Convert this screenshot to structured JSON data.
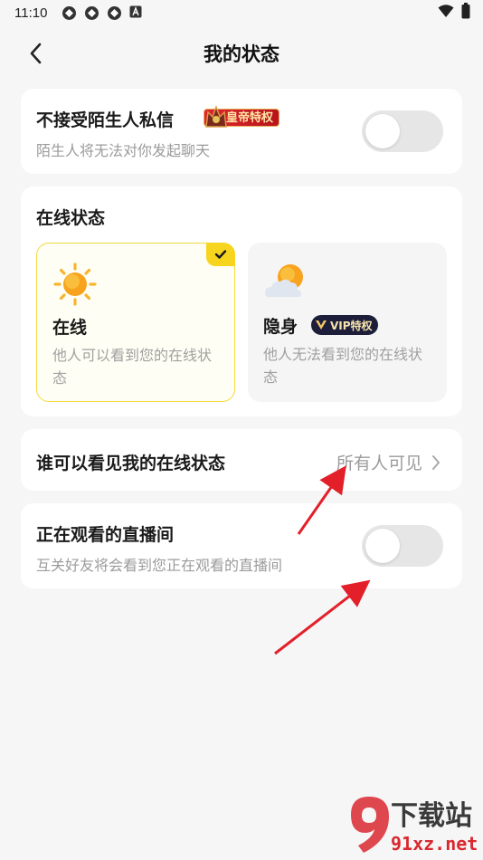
{
  "status_bar": {
    "time": "11:10",
    "notif_icons": [
      "app-notification-icon",
      "app-notification-icon",
      "app-notification-icon",
      "a-notification-icon"
    ],
    "right_icons": [
      "wifi-icon",
      "battery-icon"
    ]
  },
  "header": {
    "title": "我的状态"
  },
  "stranger_dm": {
    "title": "不接受陌生人私信",
    "badge": "皇帝特权",
    "subtitle": "陌生人将无法对你发起聊天",
    "enabled": false
  },
  "online_status": {
    "section_title": "在线状态",
    "options": [
      {
        "label": "在线",
        "description": "他人可以看到您的在线状态",
        "selected": true,
        "icon": "sun-icon"
      },
      {
        "label": "隐身",
        "badge": "VIP特权",
        "description": "他人无法看到您的在线状态",
        "selected": false,
        "icon": "cloud-sun-icon"
      }
    ]
  },
  "visibility": {
    "label": "谁可以看见我的在线状态",
    "value": "所有人可见"
  },
  "watching_live": {
    "title": "正在观看的直播间",
    "subtitle": "互关好友将会看到您正在观看的直播间",
    "enabled": false
  },
  "watermark": {
    "top": "下载站",
    "bottom": "91xz.net"
  },
  "colors": {
    "accent_yellow": "#f7d51e",
    "arrow_red": "#e3202a",
    "toggle_off": "#e6e6e6"
  }
}
